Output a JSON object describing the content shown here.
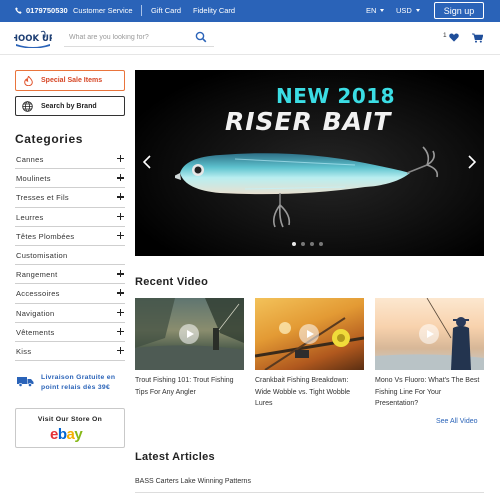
{
  "topbar": {
    "phone": "0179750530",
    "links": [
      "Customer Service",
      "Gift Card",
      "Fidelity Card"
    ],
    "language": "EN",
    "currency": "USD",
    "signup_label": "Sign up",
    "background": "#2a63b8"
  },
  "header": {
    "logo_text": "HOOK UP",
    "search_placeholder": "What are you looking for?",
    "wishlist_count": "1",
    "icons": [
      "search-icon",
      "heart-icon",
      "cart-icon"
    ]
  },
  "sidebar": {
    "special_label": "Special Sale Items",
    "brand_label": "Search by Brand",
    "categories_title": "Categories",
    "categories": [
      "Cannes",
      "Moulinets",
      "Tresses et Fils",
      "Leurres",
      "Têtes Plombées",
      "Customisation",
      "Rangement",
      "Accessoires",
      "Navigation",
      "Vêtements",
      "Kiss"
    ],
    "expandable": [
      true,
      true,
      true,
      true,
      true,
      false,
      true,
      true,
      true,
      true,
      true
    ],
    "shipping_line1": "Livraison Gratuite en",
    "shipping_line2": "point relais dès 39€",
    "store_label": "Visit Our Store On",
    "store_logo": [
      "e",
      "b",
      "a",
      "y"
    ],
    "store_logo_colors": [
      "#e53238",
      "#0064d2",
      "#f5af02",
      "#86b817"
    ]
  },
  "banner": {
    "headline": "NEW 2018",
    "title": "RISER BAIT",
    "slide_count": 4,
    "active_slide": 1
  },
  "recent_video": {
    "title": "Recent Video",
    "videos": [
      {
        "caption": "Trout Fishing 101: Trout Fishing Tips For Any Angler"
      },
      {
        "caption": "Crankbait Fishing Breakdown: Wide Wobble vs. Tight Wobble Lures"
      },
      {
        "caption": "Mono Vs Fluoro: What's The Best Fishing Line For Your Presentation?"
      }
    ],
    "see_all": "See All Video"
  },
  "articles": {
    "title": "Latest Articles",
    "items": [
      "BASS Carters Lake Winning Patterns"
    ]
  }
}
